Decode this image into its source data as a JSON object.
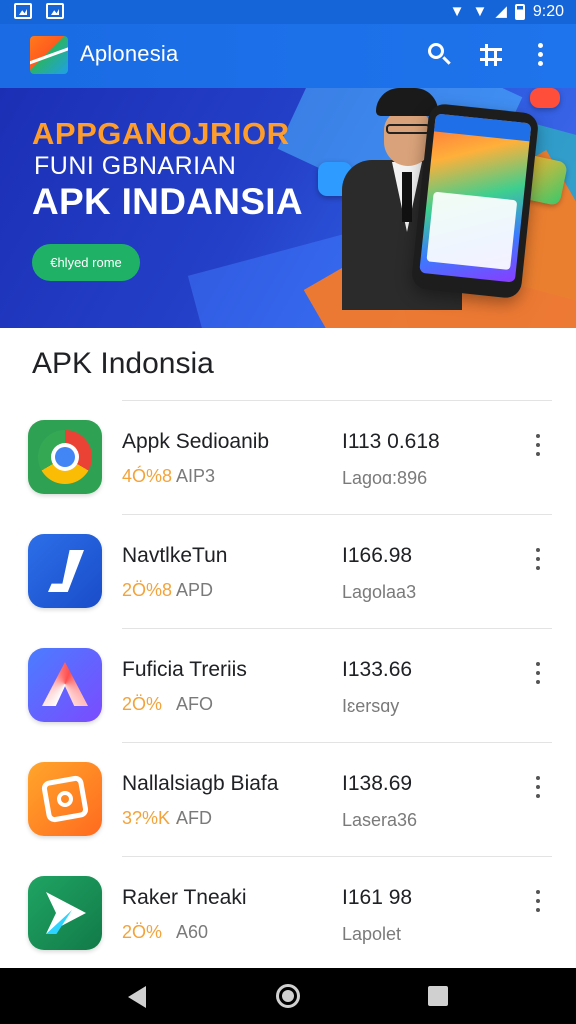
{
  "status_bar": {
    "time": "9:20",
    "icons": [
      "gallery-icon",
      "gallery-icon",
      "wifi-icon",
      "signal-icon",
      "battery-icon"
    ]
  },
  "app_bar": {
    "title": "Aplonesia",
    "actions": [
      "search-icon",
      "tune-icon",
      "more-vert-icon"
    ]
  },
  "banner": {
    "line1": "APPGANOJRIOR",
    "line2": "FUNI GBNARIAN",
    "line3": "APK INDANSIA",
    "cta": "€hlyed rome"
  },
  "section": {
    "title": "APK Indonsia"
  },
  "apps": [
    {
      "name": "Appk Sedioanib",
      "rating": "4Ó%8",
      "type": "AIP3",
      "size": "I113 0.618",
      "downloads": "Lagoɑ:896",
      "icon": "chrome-icon"
    },
    {
      "name": "NavtlkeTun",
      "rating": "2Ö%8",
      "type": "APD",
      "size": "I166.98",
      "downloads": "Lagolaa3",
      "icon": "music-icon"
    },
    {
      "name": "Fuficia Treriis",
      "rating": "2Ö%",
      "type": "AFO",
      "size": "I133.66",
      "downloads": "Iɛersɑy",
      "icon": "a-logo-icon"
    },
    {
      "name": "Nallalsiagb Biafa",
      "rating": "3?%K .",
      "type": "AFD",
      "size": "I138.69",
      "downloads": "Lasera36",
      "icon": "orange-box-icon"
    },
    {
      "name": "Raker Tneaki",
      "rating": "2Ö%",
      "type": "A60",
      "size": "I161 98",
      "downloads": "Lapolet",
      "icon": "play-icon"
    }
  ],
  "nav_bar": {
    "buttons": [
      "back-icon",
      "home-icon",
      "recents-icon"
    ]
  }
}
